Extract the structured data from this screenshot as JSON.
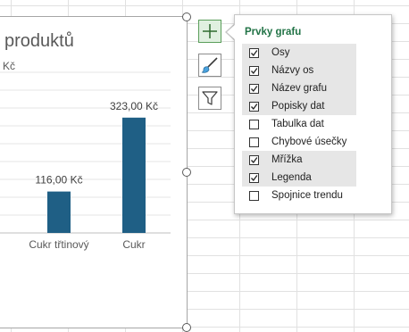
{
  "chart": {
    "title": "produktů",
    "unit_label": "Kč"
  },
  "chart_data": {
    "type": "bar",
    "categories": [
      "Cukr třtinový",
      "Cukr"
    ],
    "values": [
      116,
      323
    ],
    "data_labels": [
      "116,00 Kč",
      "323,00 Kč"
    ],
    "title": "produktů",
    "ylabel": "Kč",
    "ylim": [
      0,
      450
    ],
    "gridlines": true,
    "bar_color": "#1f5f85"
  },
  "side_buttons": [
    {
      "name": "chart-elements",
      "icon": "plus-icon",
      "active": true
    },
    {
      "name": "chart-styles",
      "icon": "paintbrush-icon",
      "active": false
    },
    {
      "name": "chart-filters",
      "icon": "funnel-icon",
      "active": false
    }
  ],
  "popup": {
    "title": "Prvky grafu",
    "items": [
      {
        "label": "Osy",
        "checked": true
      },
      {
        "label": "Názvy os",
        "checked": true
      },
      {
        "label": "Název grafu",
        "checked": true
      },
      {
        "label": "Popisky dat",
        "checked": true
      },
      {
        "label": "Tabulka dat",
        "checked": false
      },
      {
        "label": "Chybové úsečky",
        "checked": false
      },
      {
        "label": "Mřížka",
        "checked": true
      },
      {
        "label": "Legenda",
        "checked": true
      },
      {
        "label": "Spojnice trendu",
        "checked": false
      }
    ]
  },
  "colors": {
    "accent": "#217346",
    "bar": "#1f5f85",
    "selected_bg": "#e6e6e6"
  }
}
